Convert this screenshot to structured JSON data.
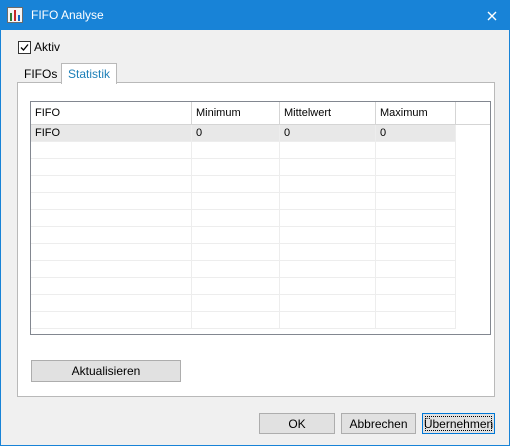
{
  "window": {
    "title": "FIFO Analyse",
    "accent": "#1883d7"
  },
  "active_checkbox": {
    "label": "Aktiv",
    "checked": true
  },
  "tabs": [
    {
      "label": "FIFOs",
      "selected": false
    },
    {
      "label": "Statistik",
      "selected": true
    }
  ],
  "grid": {
    "columns": [
      "FIFO",
      "Minimum",
      "Mittelwert",
      "Maximum"
    ],
    "rows": [
      [
        "FIFO",
        "0",
        "0",
        "0"
      ]
    ]
  },
  "buttons": {
    "update": "Aktualisieren",
    "ok": "OK",
    "cancel": "Abbrechen",
    "apply": "Übernehmen"
  }
}
